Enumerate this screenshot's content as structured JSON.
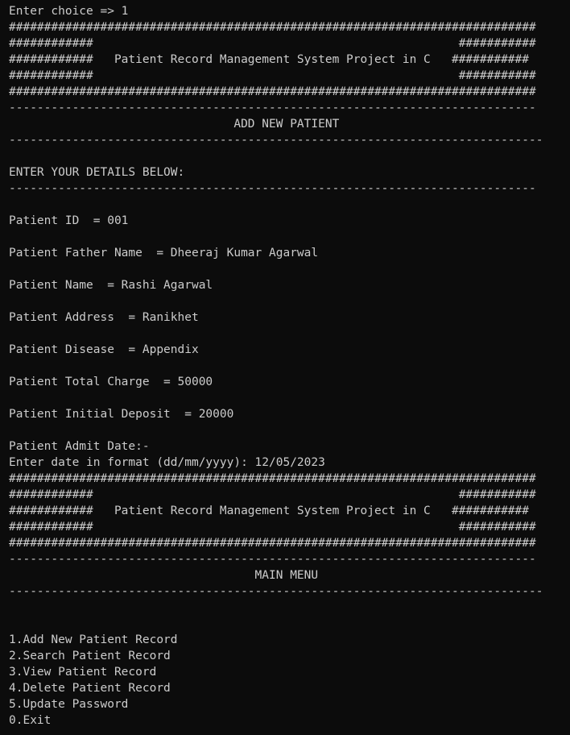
{
  "terminal": {
    "lines": [
      "Enter choice => 1",
      "###########################################################################",
      "############                                                    ###########",
      "############   Patient Record Management System Project in C   ###########",
      "############                                                    ###########",
      "###########################################################################",
      "---------------------------------------------------------------------------",
      "                                ADD NEW PATIENT",
      "----------------------------------------------------------------------------",
      "",
      "ENTER YOUR DETAILS BELOW:",
      "---------------------------------------------------------------------------",
      "",
      "Patient ID  = 001",
      "",
      "Patient Father Name  = Dheeraj Kumar Agarwal",
      "",
      "Patient Name  = Rashi Agarwal",
      "",
      "Patient Address  = Ranikhet",
      "",
      "Patient Disease  = Appendix",
      "",
      "Patient Total Charge  = 50000",
      "",
      "Patient Initial Deposit  = 20000",
      "",
      "Patient Admit Date:-",
      "Enter date in format (dd/mm/yyyy): 12/05/2023",
      "###########################################################################",
      "############                                                    ###########",
      "############   Patient Record Management System Project in C   ###########",
      "############                                                    ###########",
      "###########################################################################",
      "---------------------------------------------------------------------------",
      "                                   MAIN MENU",
      "----------------------------------------------------------------------------",
      "",
      "",
      "1.Add New Patient Record",
      "2.Search Patient Record",
      "3.View Patient Record",
      "4.Delete Patient Record",
      "5.Update Password",
      "0.Exit"
    ]
  },
  "colors": {
    "background": "#0c0c0c",
    "text": "#cccccc"
  }
}
